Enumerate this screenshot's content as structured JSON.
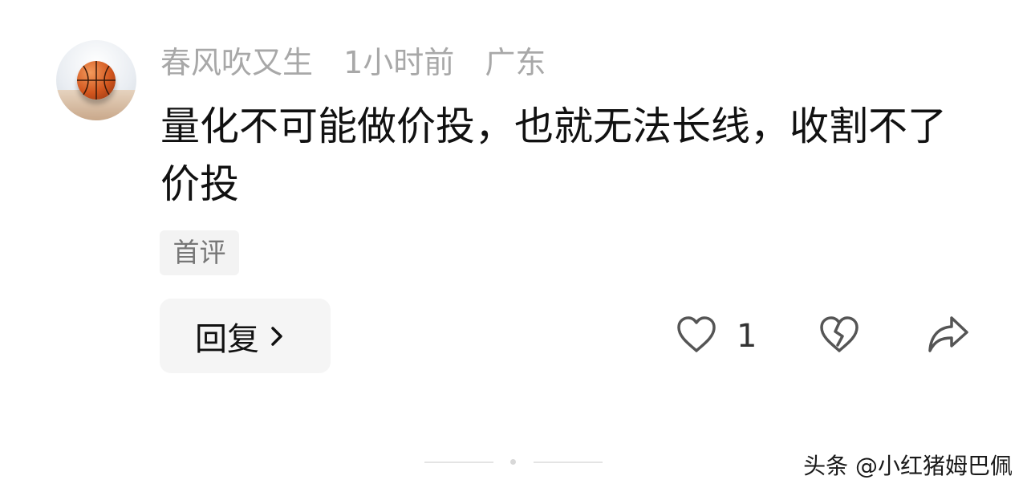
{
  "comment": {
    "username": "春风吹又生",
    "time": "1小时前",
    "location": "广东",
    "text": "量化不可能做价投，也就无法长线，收割不了价投",
    "badge": "首评",
    "avatar_icon": "basketball-avatar"
  },
  "actions": {
    "reply_label": "回复",
    "reply_icon": "chevron-right-icon",
    "like_icon": "heart-icon",
    "like_count": "1",
    "dislike_icon": "broken-heart-icon",
    "share_icon": "share-arrow-icon"
  },
  "watermark": "头条 @小红猪姆巴佩",
  "colors": {
    "meta": "#a8a8a8",
    "text": "#111111",
    "button_bg": "#f5f5f5",
    "icon": "#555555"
  }
}
